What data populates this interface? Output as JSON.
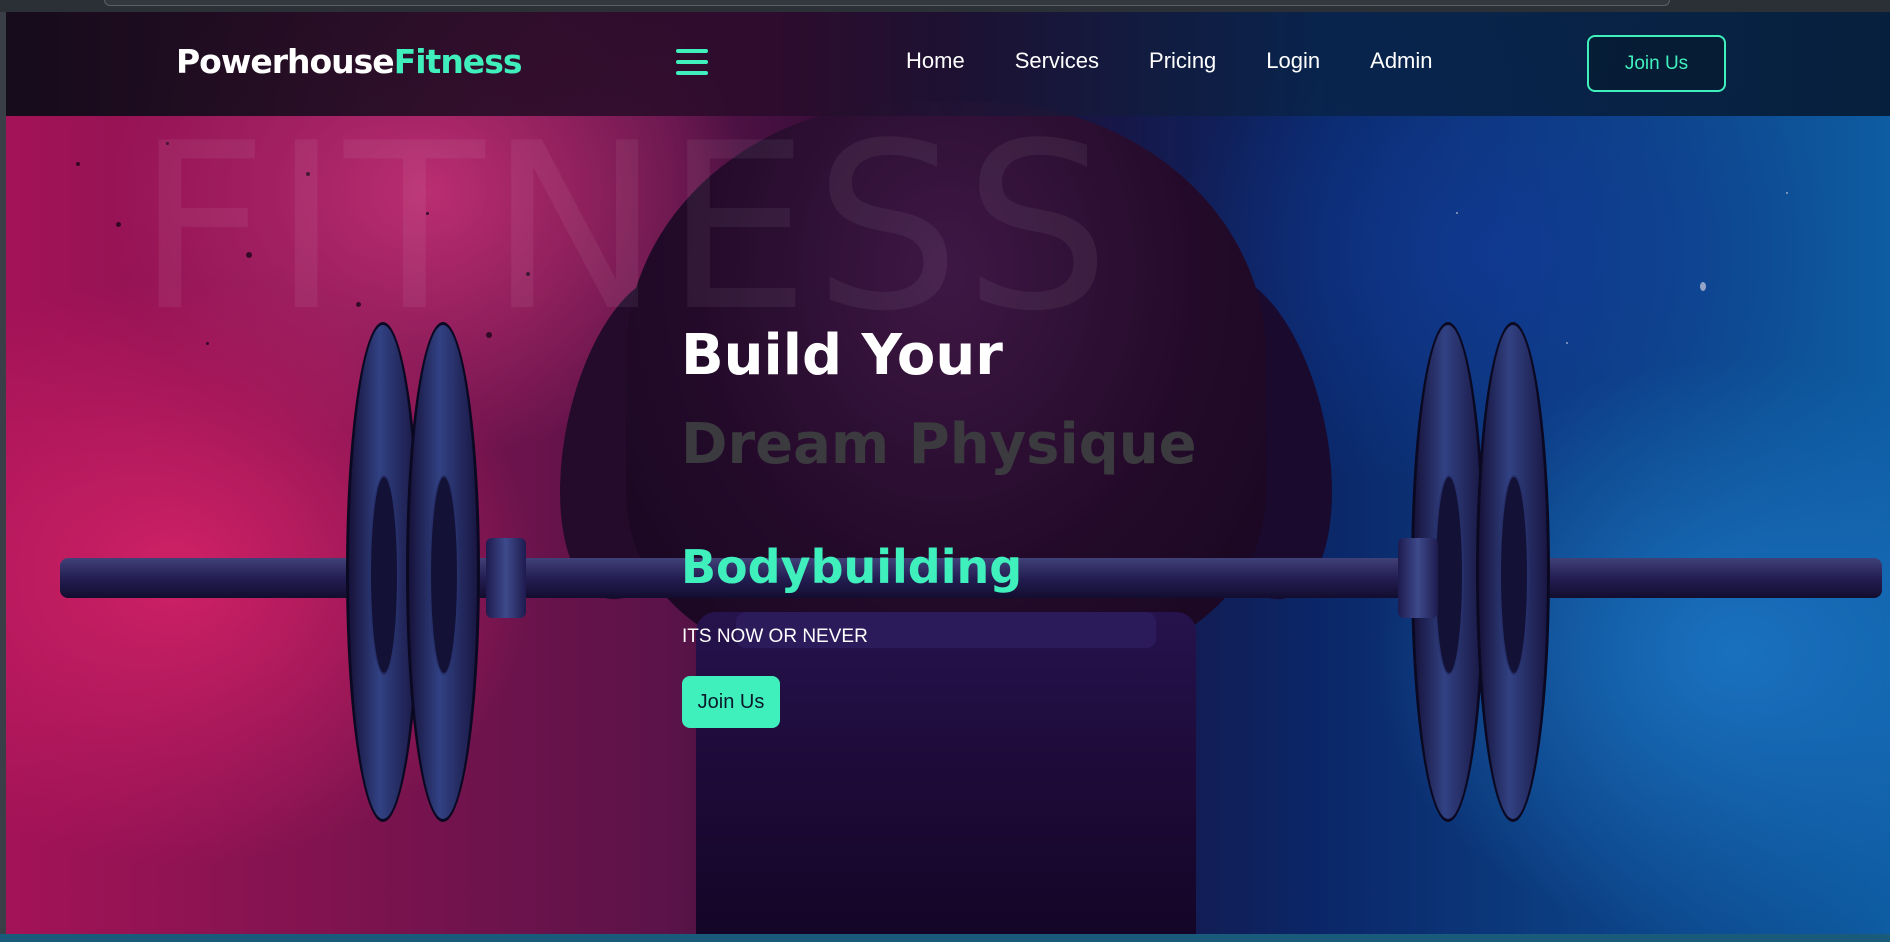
{
  "brand": {
    "name_part1": "Powerhouse",
    "name_part2": "Fitness",
    "accent_color": "#3ff0bd"
  },
  "nav": {
    "menu_icon": "hamburger-menu-icon",
    "links": [
      {
        "label": "Home"
      },
      {
        "label": "Services"
      },
      {
        "label": "Pricing"
      },
      {
        "label": "Login"
      },
      {
        "label": "Admin"
      }
    ],
    "cta_label": "Join Us"
  },
  "hero": {
    "watermark": "FITNESS",
    "title_line1": "Build Your",
    "title_line2": "Dream Physique",
    "subtitle": "Bodybuilding",
    "tagline": "ITS NOW OR NEVER",
    "cta_label": "Join Us",
    "background_image": "athlete-deadlift-barbell-image"
  }
}
